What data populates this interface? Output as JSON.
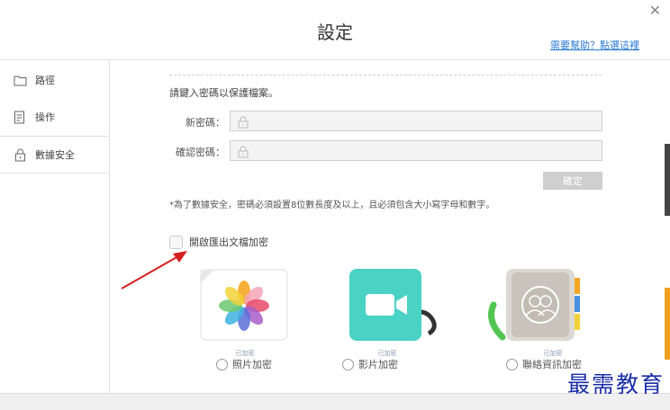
{
  "window": {
    "title": "設定",
    "help_link": "需要幫助？點選這裡"
  },
  "sidebar": {
    "items": [
      {
        "label": "路徑",
        "icon": "folder-icon"
      },
      {
        "label": "操作",
        "icon": "document-icon"
      },
      {
        "label": "數據安全",
        "icon": "lock-icon"
      }
    ]
  },
  "security": {
    "prompt": "請鍵入密碼以保護檔案。",
    "new_password_label": "新密碼：",
    "confirm_password_label": "確認密碼：",
    "confirm_button": "確定",
    "note": "*為了數據安全，密碼必須設置8位數長度及以上，且必須包含大小寫字母和數字。",
    "export_encrypt_label": "開啟匯出文檔加密"
  },
  "apps": [
    {
      "status": "已加密",
      "label": "照片加密"
    },
    {
      "status": "已加密",
      "label": "影片加密"
    },
    {
      "status": "已加密",
      "label": "聯絡資訊加密"
    }
  ],
  "watermark": "最需教育",
  "colors": {
    "link": "#2a7ad6",
    "button_disabled": "#cfcfcf",
    "facetime_green": "#4ad2c4",
    "annotation_red": "#d62020"
  }
}
